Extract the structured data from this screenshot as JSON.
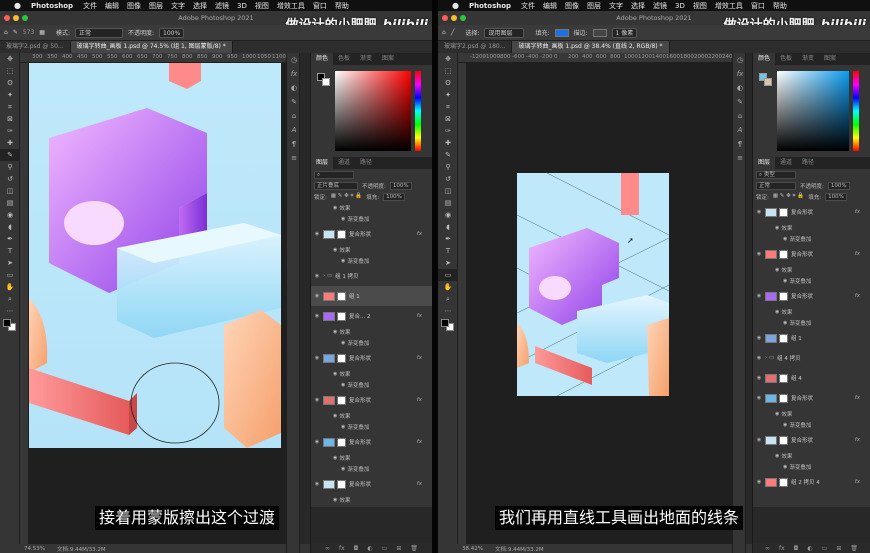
{
  "left": {
    "menubar": [
      "Photoshop",
      "文件",
      "编辑",
      "图像",
      "图层",
      "文字",
      "选择",
      "滤镜",
      "3D",
      "视图",
      "增效工具",
      "窗口",
      "帮助"
    ],
    "window_title": "Adobe Photoshop 2021",
    "brand": "做设计的小肥肥",
    "brand_logo": "bilibili",
    "options": {
      "brush_size": "573",
      "mode_label": "模式:",
      "mode_value": "正常",
      "opacity_label": "不透明度:",
      "opacity_value": "100%"
    },
    "tabs": [
      {
        "label": "玻璃字2.psd @ 50...",
        "active": false
      },
      {
        "label": "玻璃字转曲_画板 1.psd @ 74.5% (组 1, 图层蒙版/8) *",
        "active": true
      }
    ],
    "ruler_ticks": [
      "300",
      "350",
      "400",
      "450",
      "500",
      "550",
      "600",
      "650",
      "700",
      "750",
      "800",
      "850",
      "900",
      "950",
      "1000",
      "1050",
      "1100"
    ],
    "status": {
      "zoom": "74.53%",
      "doc": "文档:9.44M/33.2M"
    },
    "subtitle": "接着用蒙版擦出这个过渡",
    "panel_tabs_top": [
      "颜色",
      "色板",
      "渐变",
      "图案"
    ],
    "panel_tabs_layers": [
      "图层",
      "通道",
      "路径"
    ],
    "blend_mode": "正片叠底",
    "opacity_label": "不透明度:",
    "opacity_value": "100%",
    "lock_label": "锁定:",
    "fill_label": "填充:",
    "fill_value": "100%",
    "layers": [
      {
        "kind": "sub",
        "label": "效果"
      },
      {
        "kind": "sub2",
        "label": "渐变叠加"
      },
      {
        "kind": "layer",
        "label": "复合形状",
        "fx": "fx"
      },
      {
        "kind": "sub",
        "label": "效果"
      },
      {
        "kind": "sub2",
        "label": "渐变叠加"
      },
      {
        "kind": "group",
        "label": "组 1 拷贝"
      },
      {
        "kind": "layer",
        "label": "组 1",
        "sel": true
      },
      {
        "kind": "layer",
        "label": "复合... 2",
        "fx": "fx"
      },
      {
        "kind": "sub",
        "label": "效果"
      },
      {
        "kind": "sub2",
        "label": "渐变叠加"
      },
      {
        "kind": "layer",
        "label": "复合形状",
        "fx": "fx"
      },
      {
        "kind": "sub",
        "label": "效果"
      },
      {
        "kind": "sub2",
        "label": "渐变叠加"
      },
      {
        "kind": "layer",
        "label": "复合形状",
        "fx": "fx"
      },
      {
        "kind": "sub",
        "label": "效果"
      },
      {
        "kind": "sub2",
        "label": "渐变叠加"
      },
      {
        "kind": "layer",
        "label": "复合形状",
        "fx": "fx"
      },
      {
        "kind": "sub",
        "label": "效果"
      },
      {
        "kind": "sub2",
        "label": "渐变叠加"
      },
      {
        "kind": "layer",
        "label": "复合形状",
        "fx": "fx"
      },
      {
        "kind": "sub",
        "label": "效果"
      }
    ]
  },
  "right": {
    "menubar": [
      "Photoshop",
      "文件",
      "编辑",
      "图像",
      "图层",
      "文字",
      "选择",
      "滤镜",
      "3D",
      "视图",
      "增效工具",
      "窗口",
      "帮助"
    ],
    "window_title": "Adobe Photoshop 2021",
    "brand": "做设计的小肥肥",
    "brand_logo": "bilibili",
    "options": {
      "select_label": "选择:",
      "select_value": "现用图层",
      "fill_label": "填充:",
      "stroke_label": "描边:",
      "stroke_value": "1 像素"
    },
    "tabs": [
      {
        "label": "玻璃字2.psd @ 180...",
        "active": false
      },
      {
        "label": "玻璃字转曲_画板 1.psd @ 38.4% (直线 2, RGB/8) *",
        "active": true
      }
    ],
    "ruler_ticks": [
      "-1200",
      "-1000",
      "-800",
      "-600",
      "-400",
      "-200",
      "0",
      "200",
      "400",
      "600",
      "800",
      "1000",
      "1200",
      "1400",
      "1600",
      "1800",
      "2000",
      "2200",
      "2400"
    ],
    "status": {
      "zoom": "38.42%",
      "doc": "文档:9.44M/33.2M"
    },
    "subtitle": "我们再用直线工具画出地面的线条",
    "panel_tabs_top": [
      "颜色",
      "色板",
      "渐变",
      "图案"
    ],
    "panel_tabs_layers": [
      "图层",
      "通道",
      "路径"
    ],
    "search_placeholder": "类型",
    "blend_mode": "正常",
    "opacity_label": "不透明度:",
    "opacity_value": "100%",
    "lock_label": "锁定:",
    "fill_label": "填充:",
    "fill_value": "100%",
    "layers": [
      {
        "kind": "layer",
        "label": "复合形状",
        "fx": "fx"
      },
      {
        "kind": "sub",
        "label": "效果"
      },
      {
        "kind": "sub2",
        "label": "渐变叠加"
      },
      {
        "kind": "layer",
        "label": "复合形状",
        "fx": "fx"
      },
      {
        "kind": "sub",
        "label": "效果"
      },
      {
        "kind": "sub2",
        "label": "渐变叠加"
      },
      {
        "kind": "layer",
        "label": "复合形状",
        "fx": "fx"
      },
      {
        "kind": "sub",
        "label": "效果"
      },
      {
        "kind": "sub2",
        "label": "渐变叠加"
      },
      {
        "kind": "layer",
        "label": "组 1"
      },
      {
        "kind": "group",
        "label": "组 4 拷贝"
      },
      {
        "kind": "layer",
        "label": "组 4"
      },
      {
        "kind": "layer",
        "label": "复合形状",
        "fx": "fx"
      },
      {
        "kind": "sub",
        "label": "效果"
      },
      {
        "kind": "sub2",
        "label": "渐变叠加"
      },
      {
        "kind": "layer",
        "label": "复合形状",
        "fx": "fx"
      },
      {
        "kind": "sub",
        "label": "效果"
      },
      {
        "kind": "sub2",
        "label": "渐变叠加"
      },
      {
        "kind": "layer",
        "label": "组 2 拷贝 4",
        "fx": "fx"
      }
    ]
  }
}
